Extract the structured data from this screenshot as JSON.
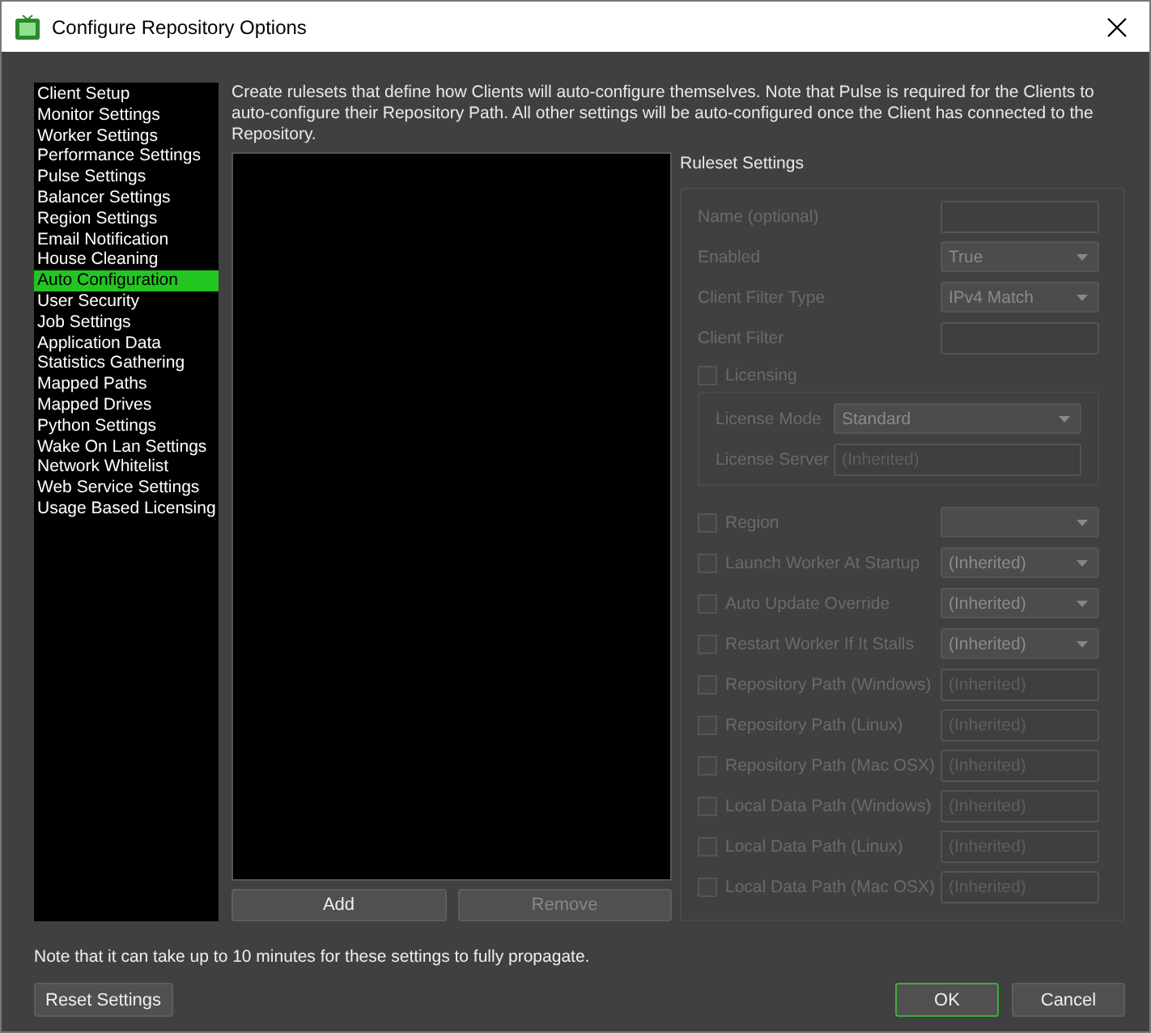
{
  "window": {
    "title": "Configure Repository Options"
  },
  "sidebar": {
    "items": [
      {
        "label": "Client Setup",
        "selected": false
      },
      {
        "label": "Monitor Settings",
        "selected": false
      },
      {
        "label": "Worker Settings",
        "selected": false
      },
      {
        "label": "Performance Settings",
        "selected": false
      },
      {
        "label": "Pulse Settings",
        "selected": false
      },
      {
        "label": "Balancer Settings",
        "selected": false
      },
      {
        "label": "Region Settings",
        "selected": false
      },
      {
        "label": "Email Notification",
        "selected": false
      },
      {
        "label": "House Cleaning",
        "selected": false
      },
      {
        "label": "Auto Configuration",
        "selected": true
      },
      {
        "label": "User Security",
        "selected": false
      },
      {
        "label": "Job Settings",
        "selected": false
      },
      {
        "label": "Application Data",
        "selected": false
      },
      {
        "label": "Statistics Gathering",
        "selected": false
      },
      {
        "label": "Mapped Paths",
        "selected": false
      },
      {
        "label": "Mapped Drives",
        "selected": false
      },
      {
        "label": "Python Settings",
        "selected": false
      },
      {
        "label": "Wake On Lan Settings",
        "selected": false
      },
      {
        "label": "Network Whitelist",
        "selected": false
      },
      {
        "label": "Web Service Settings",
        "selected": false
      },
      {
        "label": "Usage Based Licensing",
        "selected": false
      }
    ]
  },
  "description": "Create rulesets that define how Clients will auto-configure themselves. Note that Pulse is required for the Clients to auto-configure their Repository Path. All other settings will be auto-configured once the Client has connected to the Repository.",
  "rules_buttons": [
    {
      "label": "Add",
      "disabled": false
    },
    {
      "label": "Remove",
      "disabled": true
    }
  ],
  "ruleset_settings": {
    "title": "Ruleset Settings",
    "disabled": true,
    "rows": [
      {
        "kind": "text",
        "label": "Name (optional)"
      },
      {
        "kind": "select",
        "label": "Enabled",
        "value": "True"
      },
      {
        "kind": "select",
        "label": "Client Filter Type",
        "value": "IPv4 Match"
      },
      {
        "kind": "text",
        "label": "Client Filter"
      },
      {
        "kind": "group",
        "label": "Licensing",
        "checked": false,
        "children": [
          {
            "kind": "select",
            "label": "License Mode",
            "value": "Standard"
          },
          {
            "kind": "text",
            "label": "License Server",
            "placeholder": "(Inherited)"
          }
        ]
      },
      {
        "kind": "check-select",
        "label": "Region",
        "checked": false
      },
      {
        "kind": "check-select",
        "label": "Launch Worker At Startup",
        "checked": false,
        "value": "(Inherited)"
      },
      {
        "kind": "check-select",
        "label": "Auto Update Override",
        "checked": false,
        "value": "(Inherited)"
      },
      {
        "kind": "check-select",
        "label": "Restart Worker If It Stalls",
        "checked": false,
        "value": "(Inherited)"
      },
      {
        "kind": "check-text",
        "label": "Repository Path (Windows)",
        "checked": false,
        "placeholder": "(Inherited)"
      },
      {
        "kind": "check-text",
        "label": "Repository Path (Linux)",
        "checked": false,
        "placeholder": "(Inherited)"
      },
      {
        "kind": "check-text",
        "label": "Repository Path (Mac OSX)",
        "checked": false,
        "placeholder": "(Inherited)"
      },
      {
        "kind": "check-text",
        "label": "Local Data Path (Windows)",
        "checked": false,
        "placeholder": "(Inherited)"
      },
      {
        "kind": "check-text",
        "label": "Local Data Path (Linux)",
        "checked": false,
        "placeholder": "(Inherited)"
      },
      {
        "kind": "check-text",
        "label": "Local Data Path (Mac OSX)",
        "checked": false,
        "placeholder": "(Inherited)"
      }
    ]
  },
  "footer_note": "Note that it can take up to 10 minutes for these settings to fully propagate.",
  "reset_button": {
    "label": "Reset Settings"
  },
  "dialog_buttons": [
    {
      "label": "OK",
      "default": true
    },
    {
      "label": "Cancel",
      "default": false
    }
  ]
}
